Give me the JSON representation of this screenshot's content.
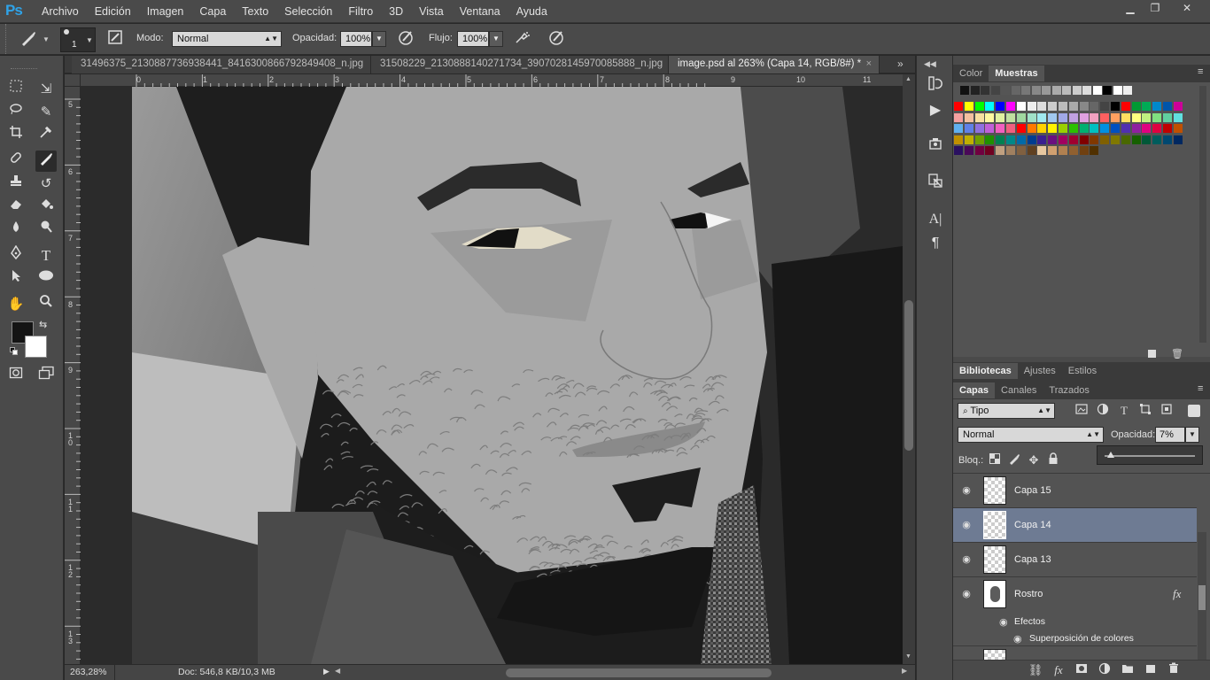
{
  "app": {
    "logo": "Ps"
  },
  "menu": [
    "Archivo",
    "Edición",
    "Imagen",
    "Capa",
    "Texto",
    "Selección",
    "Filtro",
    "3D",
    "Vista",
    "Ventana",
    "Ayuda"
  ],
  "window_controls": {
    "minimize": "▁",
    "restore": "❐",
    "close": "✕"
  },
  "options": {
    "brush_size": "1",
    "mode_label": "Modo:",
    "mode_value": "Normal",
    "opacity_label": "Opacidad:",
    "opacity_value": "100%",
    "flow_label": "Flujo:",
    "flow_value": "100%"
  },
  "tabs": [
    {
      "label": "31496375_2130887736938441_8416300866792849408_n.jpg"
    },
    {
      "label": "31508229_2130888140271734_3907028145970085888_n.jpg"
    },
    {
      "label": "image.psd al 263% (Capa 14, RGB/8#) *",
      "close": "×"
    }
  ],
  "tab_overflow": "»",
  "ruler_h": [
    "0",
    "1",
    "2",
    "3",
    "4",
    "5",
    "6",
    "7",
    "8",
    "9",
    "10",
    "11"
  ],
  "ruler_v": [
    "5",
    "6",
    "7",
    "8",
    "9",
    "1 0",
    "1 1",
    "1 2",
    "1 3"
  ],
  "status": {
    "zoom": "263,28%",
    "doc": "Doc: 546,8 KB/10,3 MB"
  },
  "swatches_panel": {
    "tabs": [
      "Color",
      "Muestras"
    ],
    "active_tab": "Muestras",
    "gray_row": [
      "#111111",
      "#222222",
      "#333333",
      "#444444",
      "#555555",
      "#666666",
      "#777777",
      "#888888",
      "#999999",
      "#aaaaaa",
      "#bbbbbb",
      "#cccccc",
      "#dddddd",
      "#ffffff",
      "#000000",
      "#ffffff",
      "#eeeeee"
    ],
    "rows": [
      [
        "#ff0000",
        "#ffff00",
        "#00ff00",
        "#00ffff",
        "#0000ff",
        "#ff00ff",
        "#ffffff",
        "#eeeeee",
        "#dddddd",
        "#cccccc",
        "#bbbbbb",
        "#aaaaaa",
        "#888888",
        "#666666",
        "#444444",
        "#000000",
        "#ff0000",
        "#009933",
        "#00aa55",
        "#0088cc",
        "#0055aa",
        "#cc0099"
      ],
      [
        "#f4a0a0",
        "#f4c0a0",
        "#f8e0a0",
        "#fff8a0",
        "#e0f0a0",
        "#c0e0a0",
        "#a0d8a0",
        "#a0e0c8",
        "#a0e8f0",
        "#a0c8f0",
        "#a0a8e8",
        "#c0a0e0",
        "#e0a0e0",
        "#f0a0c0",
        "#ff6060",
        "#ffa060",
        "#ffe060",
        "#ffff80",
        "#c0f080",
        "#80e080",
        "#60d0a0",
        "#60e0e0"
      ],
      [
        "#60b0f0",
        "#6080e8",
        "#9070e0",
        "#c060d8",
        "#f060c0",
        "#f06080",
        "#ff0000",
        "#ff7a00",
        "#ffd200",
        "#fff200",
        "#9ad000",
        "#2cc000",
        "#00b070",
        "#00c0c0",
        "#0090e0",
        "#0050c0",
        "#5030b0",
        "#9020a0",
        "#e00080",
        "#e00040",
        "#c00000",
        "#c05000"
      ],
      [
        "#c09000",
        "#c0b000",
        "#70a000",
        "#209000",
        "#008050",
        "#008888",
        "#006aa8",
        "#003c90",
        "#3a2090",
        "#6a1080",
        "#a00060",
        "#a00030",
        "#800000",
        "#803800",
        "#806000",
        "#807800",
        "#4a6800",
        "#166000",
        "#005838",
        "#005c5c",
        "#004870",
        "#002860"
      ],
      [
        "#2a1060",
        "#4a0858",
        "#700040",
        "#700020",
        "#c0a080",
        "#a08060",
        "#806040",
        "#604020",
        "#e8c8a0",
        "#d0a070",
        "#b08050",
        "#906030",
        "#704010",
        "#503000"
      ]
    ]
  },
  "layers_panel": {
    "group_tabs": [
      "Bibliotecas",
      "Ajustes",
      "Estilos"
    ],
    "group_active": "Bibliotecas",
    "sub_tabs": [
      "Capas",
      "Canales",
      "Trazados"
    ],
    "sub_active": "Capas",
    "filter_value": "Tipo",
    "blend_value": "Normal",
    "opacity_label": "Opacidad:",
    "opacity_value": "7%",
    "lock_label": "Bloq.:",
    "layers": [
      {
        "name": "Capa 15",
        "selected": false
      },
      {
        "name": "Capa 14",
        "selected": true
      },
      {
        "name": "Capa 13",
        "selected": false
      },
      {
        "name": "Rostro",
        "selected": false,
        "fx": "fx"
      }
    ],
    "effects_label": "Efectos",
    "effect_item": "Superposición de colores"
  }
}
